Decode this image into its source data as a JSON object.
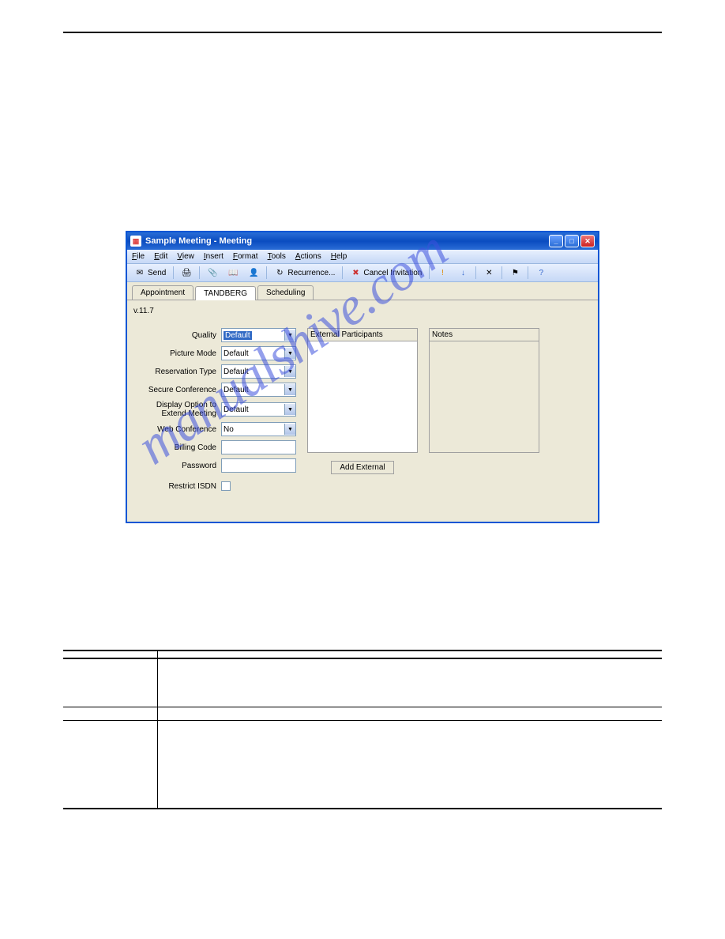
{
  "watermark": "manualshive.com",
  "window": {
    "title": "Sample Meeting - Meeting",
    "menu": [
      {
        "hk": "F",
        "rest": "ile"
      },
      {
        "hk": "E",
        "rest": "dit"
      },
      {
        "hk": "V",
        "rest": "iew"
      },
      {
        "hk": "I",
        "rest": "nsert"
      },
      {
        "hk": "F",
        "rest": "ormat"
      },
      {
        "hk": "T",
        "rest": "ools"
      },
      {
        "hk": "A",
        "rest": "ctions"
      },
      {
        "hk": "H",
        "rest": "elp"
      }
    ],
    "toolbar": {
      "send": "Send",
      "recurrence": "Recurrence...",
      "cancel": "Cancel Invitation"
    },
    "tabs": [
      "Appointment",
      "TANDBERG",
      "Scheduling"
    ],
    "version": "v.11.7",
    "form": {
      "quality": {
        "label": "Quality",
        "value": "Default"
      },
      "picture_mode": {
        "label": "Picture Mode",
        "value": "Default"
      },
      "reservation_type": {
        "label": "Reservation Type",
        "value": "Default"
      },
      "secure_conference": {
        "label": "Secure Conference",
        "value": "Default"
      },
      "display_option": {
        "label": "Display Option to Extend Meeting",
        "value": "Default"
      },
      "web_conference": {
        "label": "Web Conference",
        "value": "No"
      },
      "billing_code": {
        "label": "Billing Code",
        "value": ""
      },
      "password": {
        "label": "Password",
        "value": ""
      },
      "restrict_isdn": {
        "label": "Restrict ISDN",
        "checked": false
      }
    },
    "panels": {
      "external": "External Participants",
      "notes": "Notes",
      "add_external": "Add External"
    }
  },
  "table": {
    "header": {
      "field": "",
      "description": ""
    }
  }
}
